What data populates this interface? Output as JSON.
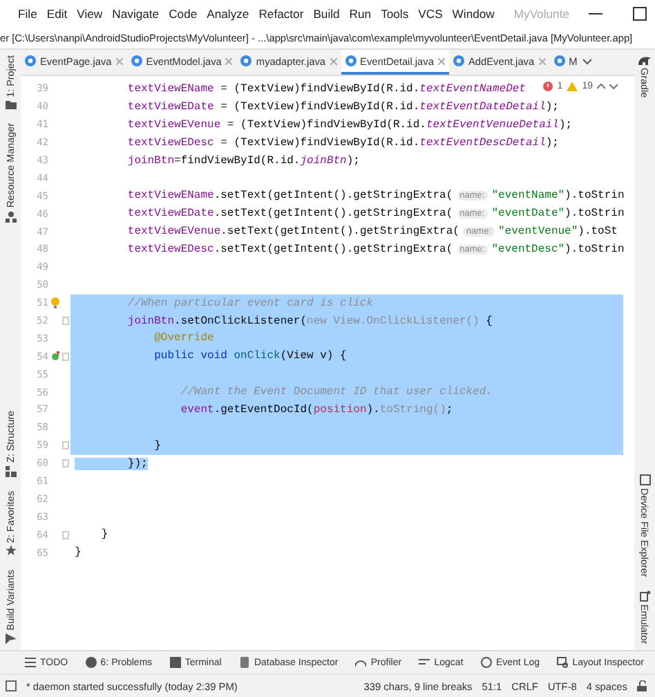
{
  "menu_bar": {
    "items": [
      "File",
      "Edit",
      "View",
      "Navigate",
      "Code",
      "Analyze",
      "Refactor",
      "Build",
      "Run",
      "Tools",
      "VCS",
      "Window"
    ],
    "project_title": "MyVolunte"
  },
  "path_bar": {
    "text": "er [C:\\Users\\nanpi\\AndroidStudioProjects\\MyVolunteer] - ...\\app\\src\\main\\java\\com\\example\\myvolunteer\\EventDetail.java [MyVolunteer.app]"
  },
  "left_toolbar": {
    "top": [
      {
        "kind": "project",
        "label": "1: Project"
      },
      {
        "kind": "resource",
        "label": "Resource Manager"
      }
    ],
    "bottom": [
      {
        "kind": "structure",
        "label": "Z: Structure"
      },
      {
        "kind": "favorites",
        "label": "2: Favorites"
      },
      {
        "kind": "build_variants",
        "label": "Build Variants"
      }
    ]
  },
  "right_toolbar": {
    "top": [
      {
        "kind": "gradle",
        "label": "Gradle"
      }
    ],
    "bottom": [
      {
        "kind": "device",
        "label": "Device File Explorer"
      },
      {
        "kind": "emulator",
        "label": "Emulator"
      }
    ]
  },
  "tabs": [
    {
      "label": "EventPage.java",
      "selected": false,
      "closable": true
    },
    {
      "label": "EventModel.java",
      "selected": false,
      "closable": true
    },
    {
      "label": "myadapter.java",
      "selected": false,
      "closable": true
    },
    {
      "label": "EventDetail.java",
      "selected": true,
      "closable": true
    },
    {
      "label": "AddEvent.java",
      "selected": false,
      "closable": true
    },
    {
      "label": "M",
      "selected": false,
      "closable": false
    }
  ],
  "editor": {
    "inspections": {
      "errors": "1",
      "warnings": "19"
    },
    "lines": [
      {
        "number": "39",
        "selected": false,
        "fold": false,
        "tokens": [
          {
            "kind": "field",
            "text": "        textViewEName"
          },
          {
            "kind": "plain",
            "text": " = (TextView)findViewById(R.id."
          },
          {
            "kind": "static",
            "text": "textEventNameDet"
          }
        ]
      },
      {
        "number": "40",
        "selected": false,
        "fold": false,
        "tokens": [
          {
            "kind": "field",
            "text": "        textViewEDate"
          },
          {
            "kind": "plain",
            "text": " = (TextView)findViewById(R.id."
          },
          {
            "kind": "static",
            "text": "textEventDateDetail"
          },
          {
            "kind": "plain",
            "text": ");"
          }
        ]
      },
      {
        "number": "41",
        "selected": false,
        "fold": false,
        "tokens": [
          {
            "kind": "field",
            "text": "        textViewEVenue"
          },
          {
            "kind": "plain",
            "text": " = (TextView)findViewById(R.id."
          },
          {
            "kind": "static",
            "text": "textEventVenueDetail"
          },
          {
            "kind": "plain",
            "text": ");"
          }
        ]
      },
      {
        "number": "42",
        "selected": false,
        "fold": false,
        "tokens": [
          {
            "kind": "field",
            "text": "        textViewEDesc"
          },
          {
            "kind": "plain",
            "text": " = (TextView)findViewById(R.id."
          },
          {
            "kind": "static",
            "text": "textEventDescDetail"
          },
          {
            "kind": "plain",
            "text": ");"
          }
        ]
      },
      {
        "number": "43",
        "selected": false,
        "fold": false,
        "tokens": [
          {
            "kind": "field",
            "text": "        joinBtn"
          },
          {
            "kind": "plain",
            "text": "=findViewById(R.id."
          },
          {
            "kind": "static",
            "text": "joinBtn"
          },
          {
            "kind": "plain",
            "text": ");"
          }
        ]
      },
      {
        "number": "44",
        "selected": false,
        "fold": false
      },
      {
        "number": "45",
        "selected": false,
        "fold": false,
        "tokens": [
          {
            "kind": "field",
            "text": "        textViewEName"
          },
          {
            "kind": "plain",
            "text": ".setText(getIntent().getStringExtra("
          },
          {
            "kind": "hint",
            "text": "name:"
          },
          {
            "kind": "string",
            "text": "\"eventName\""
          },
          {
            "kind": "plain",
            "text": ").toStrin"
          }
        ]
      },
      {
        "number": "46",
        "selected": false,
        "fold": false,
        "tokens": [
          {
            "kind": "field",
            "text": "        textViewEDate"
          },
          {
            "kind": "plain",
            "text": ".setText(getIntent().getStringExtra("
          },
          {
            "kind": "hint",
            "text": "name:"
          },
          {
            "kind": "string",
            "text": "\"eventDate\""
          },
          {
            "kind": "plain",
            "text": ").toStrin"
          }
        ]
      },
      {
        "number": "47",
        "selected": false,
        "fold": false,
        "tokens": [
          {
            "kind": "field",
            "text": "        textViewEVenue"
          },
          {
            "kind": "plain",
            "text": ".setText(getIntent().getStringExtra("
          },
          {
            "kind": "hint",
            "text": "name:"
          },
          {
            "kind": "string",
            "text": "\"eventVenue\""
          },
          {
            "kind": "plain",
            "text": ").toSt"
          }
        ]
      },
      {
        "number": "48",
        "selected": false,
        "fold": false,
        "tokens": [
          {
            "kind": "field",
            "text": "        textViewEDesc"
          },
          {
            "kind": "plain",
            "text": ".setText(getIntent().getStringExtra("
          },
          {
            "kind": "hint",
            "text": "name:"
          },
          {
            "kind": "string",
            "text": "\"eventDesc\""
          },
          {
            "kind": "plain",
            "text": ").toStrin"
          }
        ]
      },
      {
        "number": "49",
        "selected": false,
        "fold": false
      },
      {
        "number": "50",
        "selected": false,
        "fold": false
      },
      {
        "number": "51",
        "selected": true,
        "fold": false,
        "kind": "intention",
        "tokens": [
          {
            "kind": "comment",
            "text": "        //When particular event card is click"
          }
        ]
      },
      {
        "number": "52",
        "selected": true,
        "fold": true,
        "tokens": [
          {
            "kind": "field",
            "text": "        joinBtn"
          },
          {
            "kind": "plain",
            "text": ".setOnClickListener("
          },
          {
            "kind": "faded",
            "text": "new View.OnClickListener()"
          },
          {
            "kind": "plain",
            "text": " {"
          }
        ]
      },
      {
        "number": "53",
        "selected": true,
        "fold": false,
        "tokens": [
          {
            "kind": "annotation",
            "text": "            @Override"
          }
        ]
      },
      {
        "number": "54",
        "selected": true,
        "fold": true,
        "kind": "override",
        "tokens": [
          {
            "kind": "keyword",
            "text": "            public void "
          },
          {
            "kind": "method",
            "text": "onClick"
          },
          {
            "kind": "plain",
            "text": "(View v) {"
          }
        ]
      },
      {
        "number": "55",
        "selected": true,
        "fold": false
      },
      {
        "number": "56",
        "selected": true,
        "fold": false,
        "tokens": [
          {
            "kind": "comment",
            "text": "                //Want the Event Document ID that user clicked."
          }
        ]
      },
      {
        "number": "57",
        "selected": true,
        "fold": false,
        "tokens": [
          {
            "kind": "field",
            "text": "                event"
          },
          {
            "kind": "plain",
            "text": ".getEventDocId("
          },
          {
            "kind": "param",
            "text": "position"
          },
          {
            "kind": "plain",
            "text": ")."
          },
          {
            "kind": "faded",
            "text": "toString()"
          },
          {
            "kind": "plain",
            "text": ";"
          }
        ]
      },
      {
        "number": "58",
        "selected": true,
        "fold": false
      },
      {
        "number": "59",
        "selected": true,
        "fold": true,
        "tokens": [
          {
            "kind": "plain",
            "text": "            }"
          }
        ]
      },
      {
        "number": "60",
        "selected": true,
        "fold": true,
        "tokens": [
          {
            "kind": "plain",
            "text": "        });"
          }
        ]
      },
      {
        "number": "61",
        "selected": false,
        "fold": false
      },
      {
        "number": "62",
        "selected": false,
        "fold": false
      },
      {
        "number": "63",
        "selected": false,
        "fold": false
      },
      {
        "number": "64",
        "selected": false,
        "fold": true,
        "tokens": [
          {
            "kind": "plain",
            "text": "    }"
          }
        ]
      },
      {
        "number": "65",
        "selected": false,
        "fold": false,
        "tokens": [
          {
            "kind": "plain",
            "text": "}"
          }
        ]
      }
    ]
  },
  "bottom_toolbar": [
    {
      "kind": "todo",
      "label": "TODO"
    },
    {
      "kind": "problems",
      "label": "6: Problems"
    },
    {
      "kind": "terminal",
      "label": "Terminal"
    },
    {
      "kind": "database",
      "label": "Database Inspector"
    },
    {
      "kind": "profiler",
      "label": "Profiler"
    },
    {
      "kind": "logcat",
      "label": "Logcat"
    },
    {
      "kind": "event_log",
      "label": "Event Log"
    },
    {
      "kind": "layout_inspector",
      "label": "Layout Inspector"
    }
  ],
  "status_bar": {
    "message": "* daemon started successfully (today 2:39 PM)",
    "items": [
      "339 chars, 9 line breaks",
      "51:1",
      "CRLF",
      "UTF-8",
      "4 spaces"
    ]
  }
}
